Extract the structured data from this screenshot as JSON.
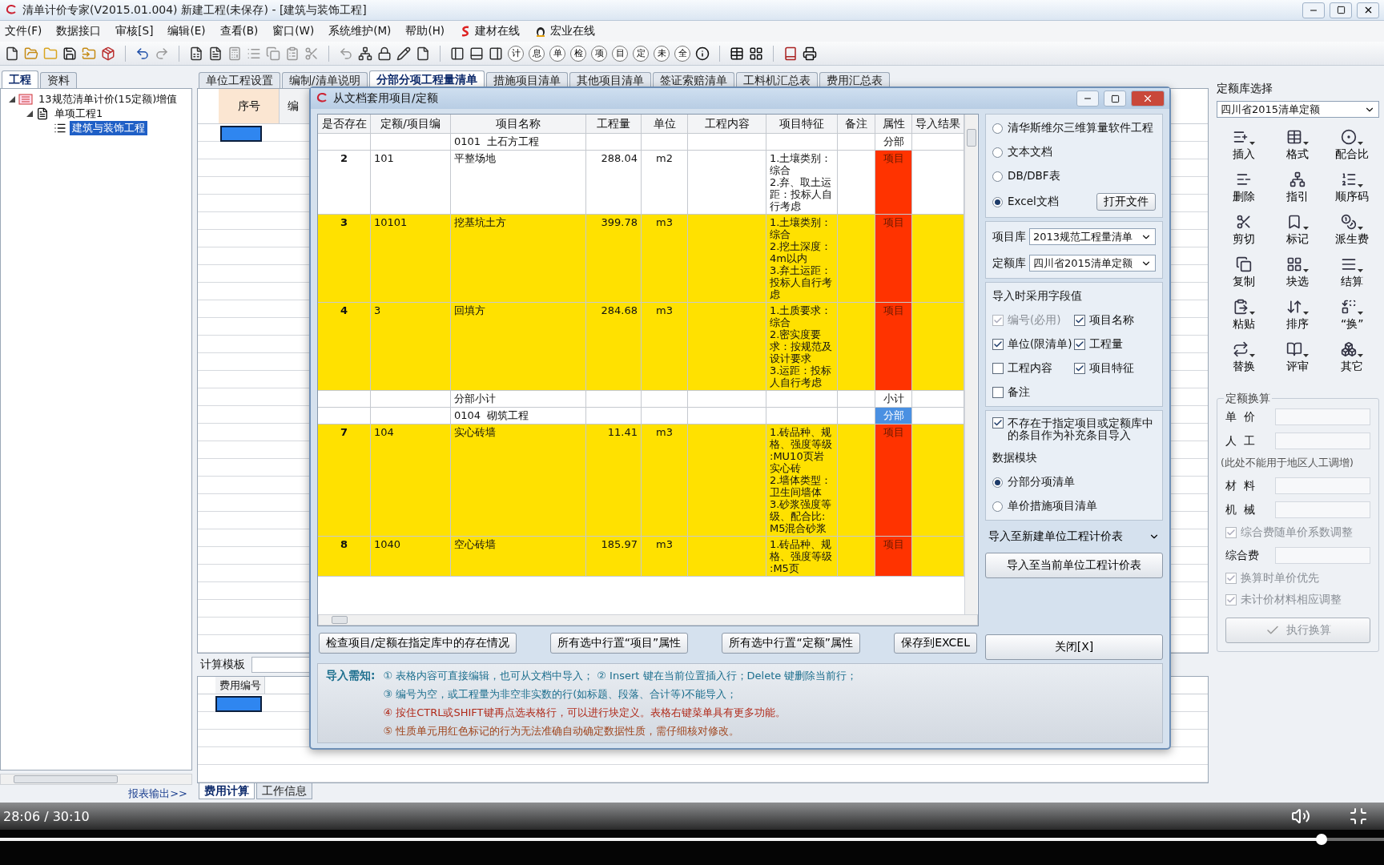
{
  "window": {
    "title": "清单计价专家(V2015.01.004) 新建工程(未保存) - [建筑与装饰工程]"
  },
  "menu": [
    "文件(F)",
    "数据接口",
    "审核[S]",
    "编辑(E)",
    "查看(B)",
    "窗口(W)",
    "系统维护(M)",
    "帮助(H)"
  ],
  "menu_links": [
    "建材在线",
    "宏业在线"
  ],
  "toolbar_glyphs": [
    "计",
    "息",
    "单",
    "检",
    "项",
    "目",
    "定",
    "未",
    "全"
  ],
  "left_panel": {
    "tabs": [
      {
        "label": "工程",
        "selected": true
      },
      {
        "label": "资料",
        "selected": false
      }
    ],
    "tree": [
      {
        "label": "13规范清单计价(15定额)增值",
        "expanded": true,
        "selected": false,
        "children": [
          {
            "label": "单项工程1",
            "expanded": true,
            "selected": false,
            "children": [
              {
                "label": "建筑与装饰工程",
                "selected": true
              }
            ]
          }
        ]
      }
    ],
    "report_link": "报表输出>>"
  },
  "main": {
    "tabs": [
      {
        "label": "单位工程设置",
        "selected": false
      },
      {
        "label": "编制/清单说明",
        "selected": false
      },
      {
        "label": "分部分项工程量清单",
        "selected": true
      },
      {
        "label": "措施项目清单",
        "selected": false
      },
      {
        "label": "其他项目清单",
        "selected": false
      },
      {
        "label": "签证索赔清单",
        "selected": false
      },
      {
        "label": "工料机汇总表",
        "selected": false
      },
      {
        "label": "费用汇总表",
        "selected": false
      }
    ],
    "grid_columns": [
      "序号",
      "编"
    ],
    "calc_template_label": "计算模板",
    "fee_columns": [
      "费用编号"
    ],
    "bottom_tabs": [
      {
        "label": "费用计算",
        "selected": true
      },
      {
        "label": "工作信息",
        "selected": false
      }
    ]
  },
  "dialog": {
    "title": "从文档套用项目/定额",
    "columns": [
      "是否存在",
      "定额/项目编",
      "项目名称",
      "工程量",
      "单位",
      "工程内容",
      "项目特征",
      "备注",
      "属性",
      "导入结果"
    ],
    "rows": [
      {
        "kind": "section",
        "name": "0101  土石方工程",
        "attr": "分部",
        "highlighted": false,
        "flagged": false,
        "selected": false
      },
      {
        "kind": "item",
        "exists": "2",
        "code": "101",
        "name": "平整场地",
        "qty": "288.04",
        "unit": "m2",
        "features": "1.土壤类别：综合\n2.弃、取土运距：投标人自行考虑",
        "attr": "项目",
        "highlighted": false,
        "flagged": true,
        "selected": false
      },
      {
        "kind": "item",
        "exists": "3",
        "code": "10101",
        "name": "挖基坑土方",
        "qty": "399.78",
        "unit": "m3",
        "features": "1.土壤类别：综合\n2.挖土深度：4m以内\n3.弃土运距：投标人自行考虑",
        "attr": "项目",
        "highlighted": true,
        "flagged": true,
        "selected": false
      },
      {
        "kind": "item",
        "exists": "4",
        "code": "3",
        "name": "回填方",
        "qty": "284.68",
        "unit": "m3",
        "features": "1.土质要求：综合\n2.密实度要求：按规范及设计要求\n3.运距：投标人自行考虑",
        "attr": "项目",
        "highlighted": true,
        "flagged": true,
        "selected": false
      },
      {
        "kind": "subtotal",
        "name": "分部小计",
        "attr": "小计",
        "highlighted": false,
        "flagged": false,
        "selected": false
      },
      {
        "kind": "section",
        "name": "0104  砌筑工程",
        "attr": "分部",
        "highlighted": false,
        "flagged": false,
        "selected": true
      },
      {
        "kind": "item",
        "exists": "7",
        "code": "104",
        "name": "实心砖墙",
        "qty": "11.41",
        "unit": "m3",
        "features": "1.砖品种、规格、强度等级 :MU10页岩实心砖\n2.墙体类型：卫生间墙体\n3.砂浆强度等级、配合比:M5混合砂浆",
        "attr": "项目",
        "highlighted": true,
        "flagged": true,
        "selected": false
      },
      {
        "kind": "item",
        "exists": "8",
        "code": "1040",
        "name": "空心砖墙",
        "qty": "185.97",
        "unit": "m3",
        "features": "1.砖品种、规格、强度等级 :M5页",
        "attr": "项目",
        "highlighted": true,
        "flagged": true,
        "selected": false
      }
    ],
    "buttons": [
      "检查项目/定额在指定库中的存在情况",
      "所有选中行置“项目”属性",
      "所有选中行置“定额”属性",
      "保存到EXCEL"
    ],
    "notes_label": "导入需知:",
    "notes": [
      {
        "text": "①  表格内容可直接编辑，也可从文档中导入；  ②  Insert 键在当前位置插入行；Delete 键删除当前行；",
        "color": "#1d6f8e"
      },
      {
        "text": "③  编号为空，或工程量为非空非实数的行(如标题、段落、合计等)不能导入；",
        "color": "#1d6f8e"
      },
      {
        "text": "④  按住CTRL或SHIFT键再点选表格行，可以进行块定义。表格右键菜单具有更多功能。",
        "color": "#b02a1a"
      },
      {
        "text": "⑤  性质单元用红色标记的行为无法准确自动确定数据性质，需仔细核对修改。",
        "color": "#a0461e"
      }
    ],
    "sources": [
      {
        "label": "清华斯维尔三维算量软件工程",
        "selected": false
      },
      {
        "label": "文本文档",
        "selected": false
      },
      {
        "label": "DB/DBF表",
        "selected": false
      },
      {
        "label": "Excel文档",
        "selected": true
      }
    ],
    "open_file_button": "打开文件",
    "libraries": [
      {
        "label": "项目库",
        "value": "2013规范工程量清单"
      },
      {
        "label": "定额库",
        "value": "四川省2015清单定额"
      }
    ],
    "fields_title": "导入时采用字段值",
    "fields": [
      {
        "label": "编号(必用)",
        "checked": true,
        "disabled": true
      },
      {
        "label": "项目名称",
        "checked": true,
        "disabled": false
      },
      {
        "label": "单位(限清单)",
        "checked": true,
        "disabled": false
      },
      {
        "label": "工程量",
        "checked": true,
        "disabled": false
      },
      {
        "label": "工程内容",
        "checked": false,
        "disabled": false
      },
      {
        "label": "项目特征",
        "checked": true,
        "disabled": false
      },
      {
        "label": "备注",
        "checked": false,
        "disabled": false
      }
    ],
    "supplement": {
      "label": "不存在于指定项目或定额库中的条目作为补充条目导入",
      "checked": true
    },
    "module_title": "数据模块",
    "modules": [
      {
        "label": "分部分项清单",
        "selected": true
      },
      {
        "label": "单价措施项目清单",
        "selected": false
      }
    ],
    "import_new_button": "导入至新建单位工程计价表",
    "import_current_button": "导入至当前单位工程计价表",
    "close_button": "关闭[X]"
  },
  "right_panel": {
    "title": "定额库选择",
    "library": "四川省2015清单定额",
    "tools": [
      {
        "label": "插入",
        "has_menu": true
      },
      {
        "label": "格式",
        "has_menu": true
      },
      {
        "label": "配合比",
        "has_menu": true
      },
      {
        "label": "删除",
        "has_menu": false
      },
      {
        "label": "指引",
        "has_menu": false
      },
      {
        "label": "顺序码",
        "has_menu": true
      },
      {
        "label": "剪切",
        "has_menu": false
      },
      {
        "label": "标记",
        "has_menu": true
      },
      {
        "label": "派生费",
        "has_menu": true
      },
      {
        "label": "复制",
        "has_menu": false
      },
      {
        "label": "块选",
        "has_menu": true
      },
      {
        "label": "结算",
        "has_menu": true
      },
      {
        "label": "粘贴",
        "has_menu": true
      },
      {
        "label": "排序",
        "has_menu": true
      },
      {
        "label": "“换”",
        "has_menu": true
      },
      {
        "label": "替换",
        "has_menu": true
      },
      {
        "label": "评审",
        "has_menu": true
      },
      {
        "label": "其它",
        "has_menu": true
      }
    ],
    "calc_title": "定额换算",
    "calc_items": [
      {
        "kind": "field",
        "label": "单  价"
      },
      {
        "kind": "field",
        "label": "人  工"
      },
      {
        "kind": "note",
        "label": "(此处不能用于地区人工调增)"
      },
      {
        "kind": "field",
        "label": "材  料"
      },
      {
        "kind": "field",
        "label": "机  械"
      },
      {
        "kind": "check",
        "label": "综合费随单价系数调整",
        "checked": true
      },
      {
        "kind": "field",
        "label": "综合费"
      },
      {
        "kind": "check",
        "label": "换算时单价优先",
        "checked": true
      },
      {
        "kind": "check",
        "label": "未计价材料相应调整",
        "checked": true
      }
    ],
    "run_button": {
      "label": "执行换算",
      "disabled": true
    }
  },
  "player": {
    "time": "28:06 / 30:10",
    "progress": {
      "level": 0.955
    }
  }
}
